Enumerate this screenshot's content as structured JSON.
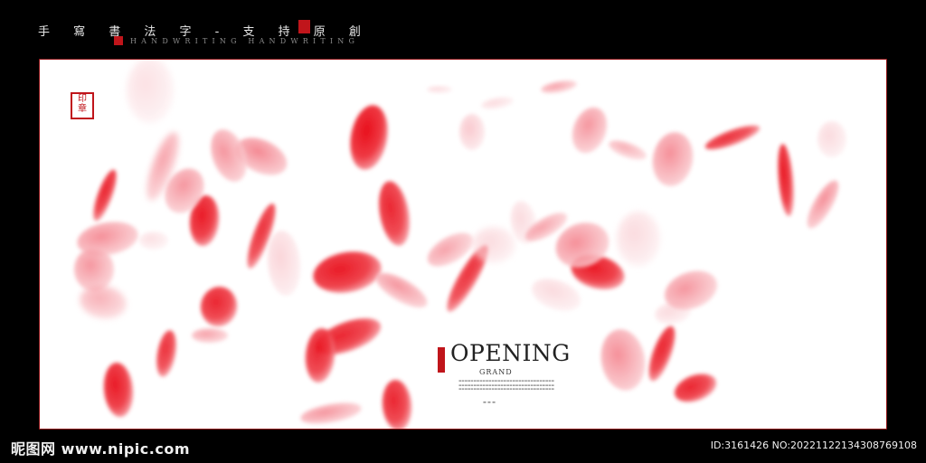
{
  "header": {
    "title_cn": "手 寫 書 法 字   - 支 持 原 創",
    "subtitle_en": "HANDWRITING HANDWRITING"
  },
  "poster": {
    "title": "OPENING",
    "subtitle": "GRAND"
  },
  "footer": {
    "site": "昵图网 www.nipic.com",
    "id_text": "ID:3161426 NO:20221122134308769108"
  },
  "colors": {
    "background": "#000000",
    "canvas": "#ffffff",
    "petal_red": "#e8262f",
    "petal_pink": "#f3a0a8",
    "seal_red": "#c0151b"
  }
}
